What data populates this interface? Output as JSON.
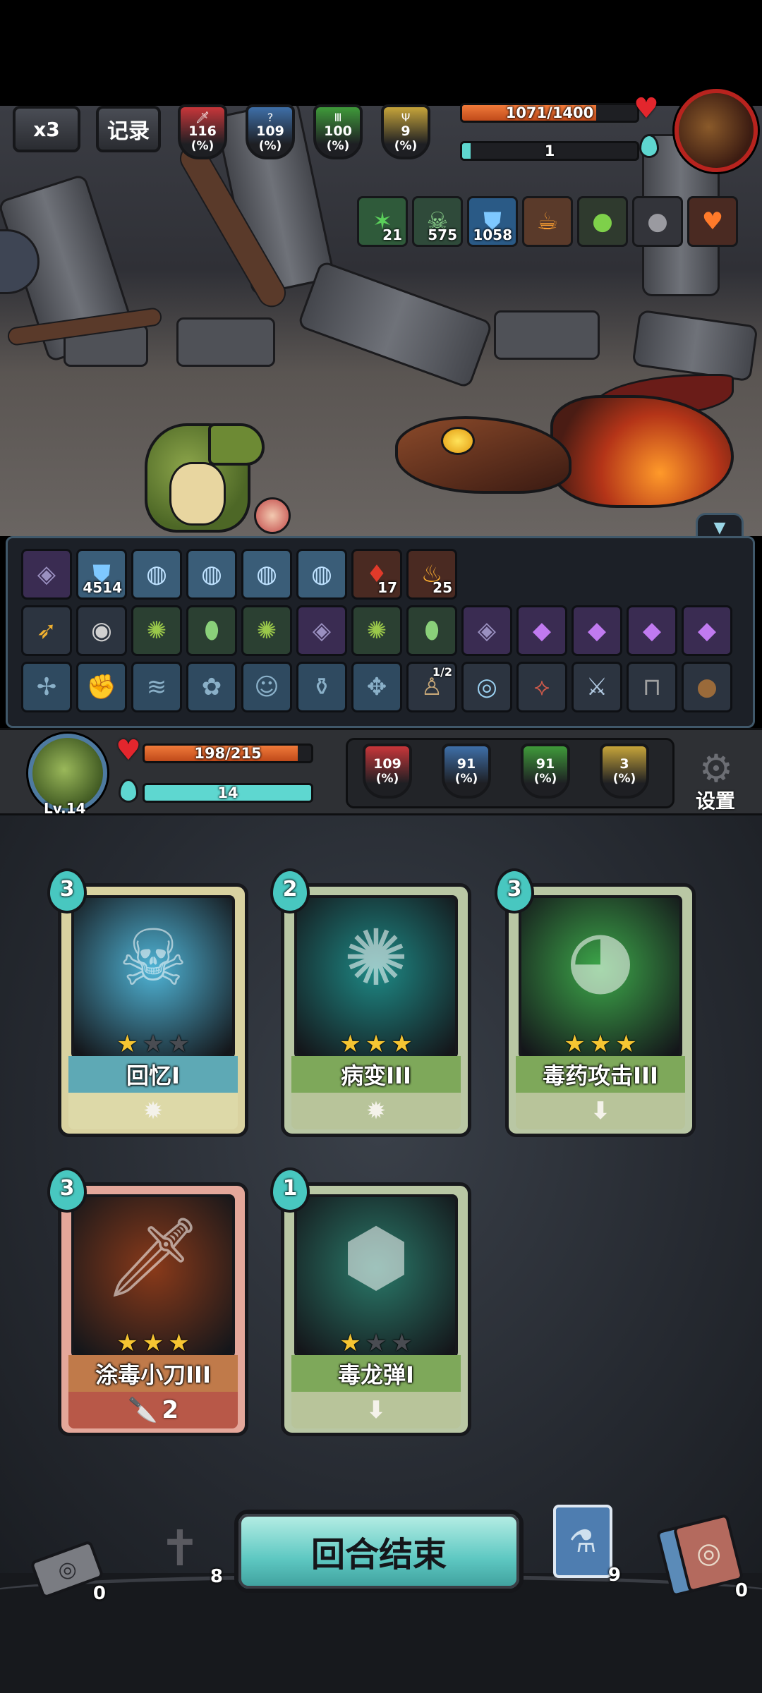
{
  "top": {
    "speed_label": "x3",
    "log_label": "记录",
    "enemy_stats": [
      {
        "value": "116",
        "pct": "(%)",
        "color": "#c8363a",
        "icon": "sword-icon"
      },
      {
        "value": "109",
        "pct": "(%)",
        "color": "#3e6fa8",
        "icon": "question-icon"
      },
      {
        "value": "100",
        "pct": "(%)",
        "color": "#3f9a3a",
        "icon": "pillar-icon"
      },
      {
        "value": "9",
        "pct": "(%)",
        "color": "#c6a43a",
        "icon": "trident-icon"
      }
    ],
    "enemy_hp_text": "1071/1400",
    "enemy_hp_fraction": 0.765,
    "enemy_energy_text": "1",
    "enemy_energy_fraction": 0.05,
    "enemy_buffs": [
      {
        "icon": "thorns-icon",
        "count": "21",
        "bg": "#2f5a3a"
      },
      {
        "icon": "poison-skull-icon",
        "count": "575",
        "bg": "#2f4a3a"
      },
      {
        "icon": "shield-icon",
        "count": "1058",
        "bg": "#2a5a86"
      },
      {
        "icon": "fire-cup-icon",
        "count": "",
        "bg": "#5a3a2a"
      },
      {
        "icon": "green-orb-icon",
        "count": "",
        "bg": "#2f3a2e"
      },
      {
        "icon": "dark-orb-icon",
        "count": "",
        "bg": "#33343a"
      },
      {
        "icon": "burning-heart-icon",
        "count": "",
        "bg": "#4a2a22"
      }
    ]
  },
  "panel": {
    "row1": [
      {
        "icon": "rune-stone-icon",
        "count": "",
        "kind": "purple"
      },
      {
        "icon": "shield-icon",
        "count": "4514",
        "kind": "blue"
      },
      {
        "icon": "spiral-drop-icon",
        "count": "",
        "kind": "blue"
      },
      {
        "icon": "spiral-drop-icon",
        "count": "",
        "kind": "blue"
      },
      {
        "icon": "spiral-drop-icon",
        "count": "",
        "kind": "blue"
      },
      {
        "icon": "spiral-drop-icon",
        "count": "",
        "kind": "blue"
      },
      {
        "icon": "blood-drop-icon",
        "count": "17",
        "kind": "red"
      },
      {
        "icon": "flame-figure-icon",
        "count": "25",
        "kind": "red"
      }
    ],
    "row2": [
      {
        "icon": "golden-horn-icon",
        "count": "",
        "kind": "normal"
      },
      {
        "icon": "eye-mask-icon",
        "count": "",
        "kind": "normal"
      },
      {
        "icon": "croc-token-icon",
        "count": "",
        "kind": "green"
      },
      {
        "icon": "green-egg-icon",
        "count": "",
        "kind": "green"
      },
      {
        "icon": "croc-token-icon",
        "count": "",
        "kind": "green"
      },
      {
        "icon": "rune-stone-icon",
        "count": "",
        "kind": "purple"
      },
      {
        "icon": "croc-token-icon",
        "count": "",
        "kind": "green"
      },
      {
        "icon": "green-egg-icon",
        "count": "",
        "kind": "green"
      },
      {
        "icon": "rune-stone-icon",
        "count": "",
        "kind": "purple"
      },
      {
        "icon": "purple-crystal-icon",
        "count": "",
        "kind": "purple"
      },
      {
        "icon": "purple-crystal-icon",
        "count": "",
        "kind": "purple"
      },
      {
        "icon": "purple-crystal-icon",
        "count": "",
        "kind": "purple"
      },
      {
        "icon": "purple-crystal-icon",
        "count": "",
        "kind": "purple"
      }
    ],
    "row3": [
      {
        "icon": "dim-rune-icon",
        "count": "",
        "kind": "dim"
      },
      {
        "icon": "dim-fist-icon",
        "count": "",
        "kind": "dim"
      },
      {
        "icon": "dim-waves-icon",
        "count": "",
        "kind": "dim"
      },
      {
        "icon": "dim-plant-icon",
        "count": "",
        "kind": "dim"
      },
      {
        "icon": "dim-face-icon",
        "count": "",
        "kind": "dim"
      },
      {
        "icon": "dim-potion-icon",
        "count": "",
        "kind": "dim"
      },
      {
        "icon": "dim-swirl-icon",
        "count": "",
        "kind": "dim"
      },
      {
        "icon": "scarecrow-icon",
        "count": "1/2",
        "kind": "normal"
      },
      {
        "icon": "amulet-icon",
        "count": "",
        "kind": "normal"
      },
      {
        "icon": "red-feather-icon",
        "count": "",
        "kind": "normal"
      },
      {
        "icon": "dagger-icon",
        "count": "",
        "kind": "normal"
      },
      {
        "icon": "trap-icon",
        "count": "",
        "kind": "normal"
      },
      {
        "icon": "seed-bag-icon",
        "count": "",
        "kind": "normal"
      }
    ]
  },
  "player": {
    "level_label": "Lv.14",
    "hp_text": "198/215",
    "hp_fraction": 0.92,
    "energy_text": "14",
    "energy_fraction": 1.0,
    "stats": [
      {
        "value": "109",
        "pct": "(%)",
        "color": "#c8363a"
      },
      {
        "value": "91",
        "pct": "(%)",
        "color": "#3e6fa8"
      },
      {
        "value": "91",
        "pct": "(%)",
        "color": "#3f9a3a"
      },
      {
        "value": "3",
        "pct": "(%)",
        "color": "#c6a43a"
      }
    ],
    "settings_label": "设置"
  },
  "hand": [
    {
      "name": "回忆I",
      "cost": "3",
      "stars": 1,
      "art_icon": "skull-rune-icon",
      "art_bg": "#4fb4d6",
      "frame": "#d9d2a0",
      "name_bg": "#5ea9b5",
      "foot_bg": "#ddd9a8",
      "foot_icon": "lightbulb-icon",
      "foot_text": ""
    },
    {
      "name": "病变III",
      "cost": "2",
      "stars": 3,
      "art_icon": "virus-icon",
      "art_bg": "#1e8a86",
      "frame": "#b9c7a4",
      "name_bg": "#7ea85a",
      "foot_bg": "#b8c49a",
      "foot_icon": "lightbulb-icon",
      "foot_text": ""
    },
    {
      "name": "毒药攻击III",
      "cost": "3",
      "stars": 3,
      "art_icon": "poison-orb-icon",
      "art_bg": "#3da84a",
      "frame": "#b9c7a4",
      "name_bg": "#7ea85a",
      "foot_bg": "#b8c49a",
      "foot_icon": "arrow-down-icon",
      "foot_text": ""
    },
    {
      "name": "涂毒小刀III",
      "cost": "3",
      "stars": 3,
      "art_icon": "poison-dagger-icon",
      "art_bg": "#8a3a1a",
      "frame": "#e4a79a",
      "name_bg": "#c07a4a",
      "foot_bg": "#b85848",
      "foot_icon": "knife-icon",
      "foot_text": "2"
    },
    {
      "name": "毒龙弹I",
      "cost": "1",
      "stars": 1,
      "art_icon": "dragon-bomb-icon",
      "art_bg": "#2a7a6a",
      "frame": "#b9c7a4",
      "name_bg": "#7ea85a",
      "foot_bg": "#b8c49a",
      "foot_icon": "arrow-down-icon",
      "foot_text": ""
    }
  ],
  "bottom": {
    "exhaust_count": "0",
    "grave_count": "8",
    "end_turn_label": "回合结束",
    "potion_count": "9",
    "draw_count": "0"
  }
}
